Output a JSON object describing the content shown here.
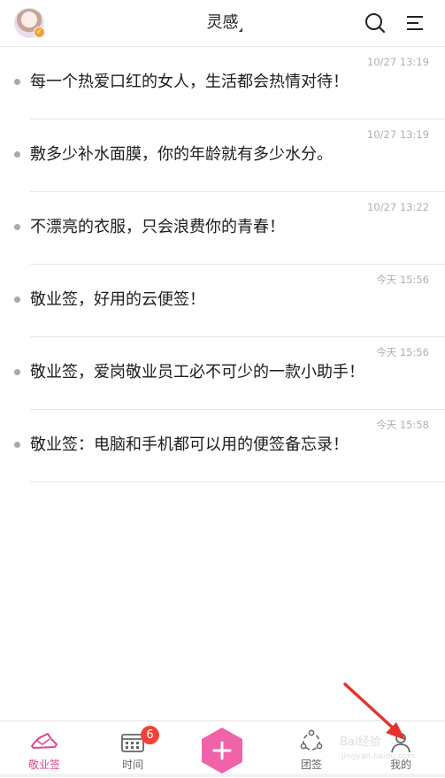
{
  "header": {
    "title": "灵感"
  },
  "notes": [
    {
      "time": "10/27 13:19",
      "text": "每一个热爱口红的女人，生活都会热情对待！"
    },
    {
      "time": "10/27 13:19",
      "text": "敷多少补水面膜，你的年龄就有多少水分。"
    },
    {
      "time": "10/27 13:22",
      "text": "不漂亮的衣服，只会浪费你的青春！"
    },
    {
      "time": "今天 15:56",
      "text": "敬业签，好用的云便签！"
    },
    {
      "time": "今天 15:56",
      "text": "敬业签，爱岗敬业员工必不可少的一款小助手！"
    },
    {
      "time": "今天 15:58",
      "text": "敬业签：电脑和手机都可以用的便签备忘录！"
    }
  ],
  "tabbar": {
    "tabs": [
      {
        "label": "敬业签",
        "icon": "pen-hat-icon",
        "active": true
      },
      {
        "label": "时间",
        "icon": "calendar-icon",
        "badge": "6"
      },
      {
        "label": "",
        "icon": "add-icon"
      },
      {
        "label": "团签",
        "icon": "team-icon"
      },
      {
        "label": "我的",
        "icon": "user-icon"
      }
    ]
  },
  "watermark": {
    "text": "Bai经验",
    "url": "jingyan.baidu.com"
  },
  "colors": {
    "accent": "#e0468f",
    "badge": "#f04338",
    "arrow": "#e5322d",
    "add_button": "#f063a8"
  }
}
